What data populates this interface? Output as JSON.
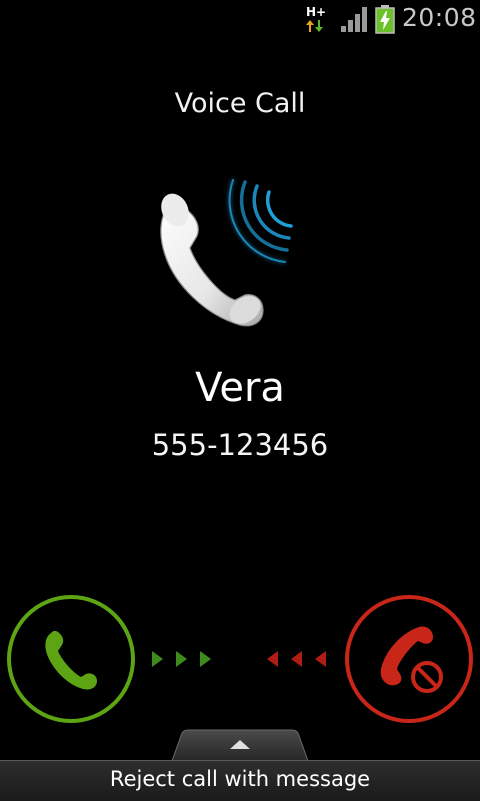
{
  "status_bar": {
    "network_type": "H+",
    "time": "20:08",
    "icons": [
      "network-hplus-icon",
      "signal-strength-icon",
      "battery-charging-icon"
    ]
  },
  "call": {
    "label": "Voice Call",
    "caller_name": "Vera",
    "caller_number": "555-123456"
  },
  "controls": {
    "answer_icon": "phone-answer-icon",
    "reject_icon": "phone-reject-icon",
    "reject_message_label": "Reject call with message"
  },
  "colors": {
    "answer": "#5da414",
    "reject": "#c9261a",
    "ring_waves": "#1ea0d8"
  }
}
